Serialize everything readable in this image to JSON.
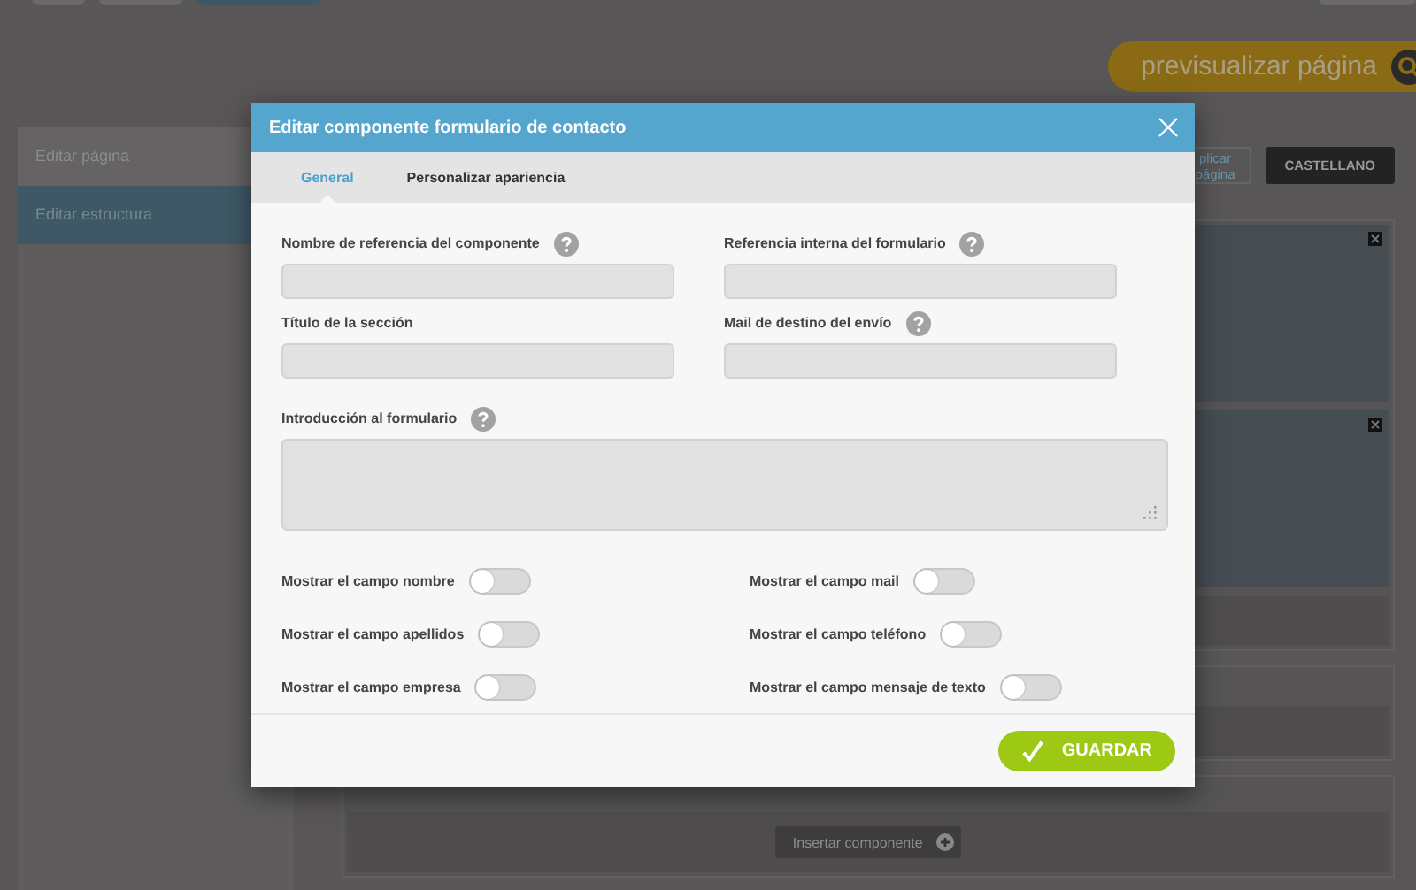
{
  "preview_button": {
    "label": "previsualizar página"
  },
  "sidebar": {
    "items": [
      {
        "label": "Editar página",
        "selected": false
      },
      {
        "label": "Editar estructura",
        "selected": true
      }
    ]
  },
  "page_actions": [
    {
      "label": "plicar página",
      "kind": "outline"
    },
    {
      "label": "CASTELLANO",
      "kind": "dark"
    }
  ],
  "insert_button": {
    "label": "Insertar componente"
  },
  "dialog": {
    "title": "Editar componente formulario de contacto",
    "tabs": [
      {
        "label": "General",
        "selected": true
      },
      {
        "label": "Personalizar apariencia",
        "selected": false
      }
    ],
    "field_columns": [
      [
        {
          "label": "Nombre de referencia del componente",
          "help": true
        },
        {
          "label": "Título de la sección",
          "help": false
        }
      ],
      [
        {
          "label": "Referencia interna del formulario",
          "help": true
        },
        {
          "label": "Mail de destino del envío",
          "help": true
        }
      ]
    ],
    "intro": {
      "label": "Introducción al formulario",
      "help": true
    },
    "toggle_columns": [
      [
        {
          "label": "Mostrar el campo nombre",
          "on": false
        },
        {
          "label": "Mostrar el campo apellidos",
          "on": false
        },
        {
          "label": "Mostrar el campo empresa",
          "on": false
        }
      ],
      [
        {
          "label": "Mostrar el campo mail",
          "on": false
        },
        {
          "label": "Mostrar el campo teléfono",
          "on": false
        },
        {
          "label": "Mostrar el campo mensaje de texto",
          "on": false
        }
      ]
    ],
    "save_button": {
      "label": "GUARDAR"
    }
  }
}
